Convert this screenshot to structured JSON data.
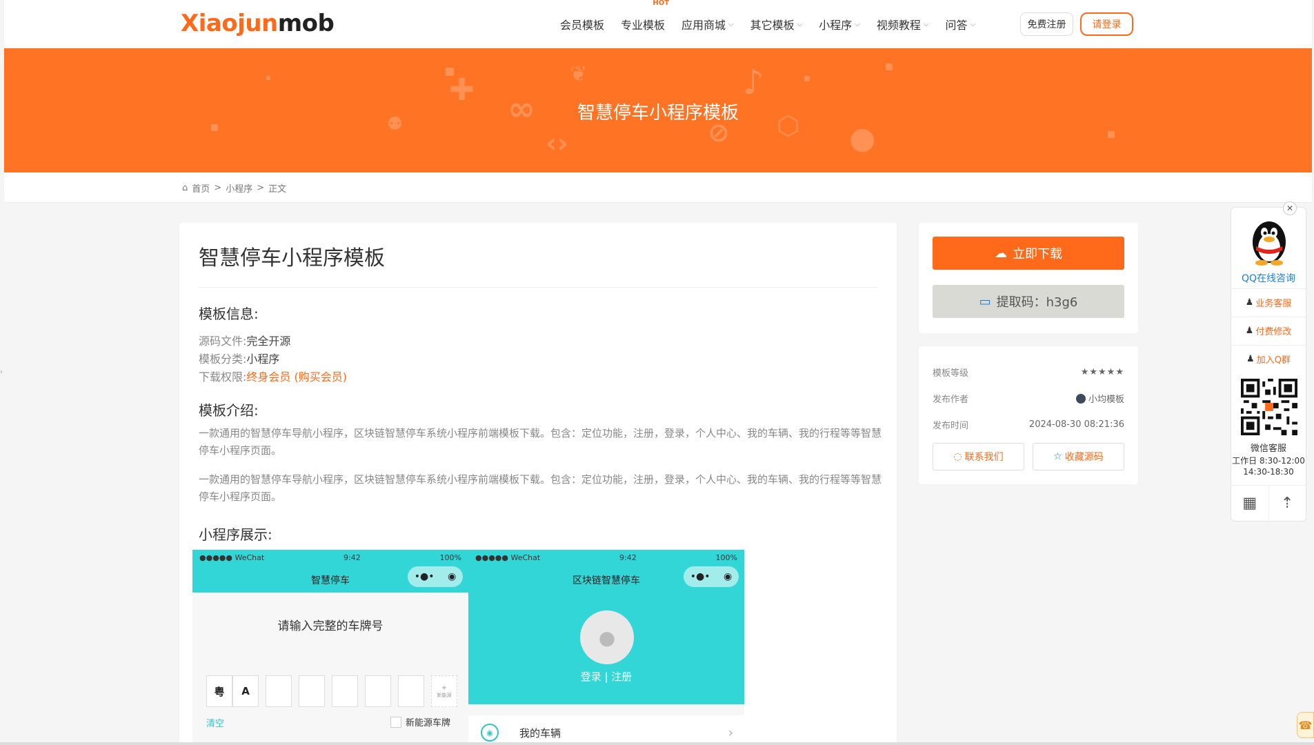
{
  "header": {
    "logo_part1": "Xiaojun",
    "logo_part2": "mob",
    "nav": [
      {
        "label": "会员模板",
        "chevron": false,
        "hot": false
      },
      {
        "label": "专业模板",
        "chevron": false,
        "hot": true
      },
      {
        "label": "应用商城",
        "chevron": true,
        "hot": false
      },
      {
        "label": "其它模板",
        "chevron": true,
        "hot": false
      },
      {
        "label": "小程序",
        "chevron": true,
        "hot": false
      },
      {
        "label": "视频教程",
        "chevron": true,
        "hot": false
      },
      {
        "label": "问答",
        "chevron": true,
        "hot": false
      }
    ],
    "hot_badge": "HOT",
    "register_label": "免费注册",
    "login_label": "请登录"
  },
  "banner": {
    "title": "智慧停车小程序模板"
  },
  "breadcrumb": {
    "home": "首页",
    "sep1": ">",
    "category": "小程序",
    "sep2": ">",
    "current": "正文"
  },
  "article": {
    "title": "智慧停车小程序模板",
    "info_heading": "模板信息:",
    "info": [
      {
        "key": "源码文件:",
        "value": "完全开源",
        "highlight": false
      },
      {
        "key": "模板分类:",
        "value": "小程序",
        "highlight": false
      },
      {
        "key": "下载权限:",
        "value": "终身会员  (购买会员)",
        "highlight": true
      }
    ],
    "intro_heading": "模板介绍:",
    "intro_paragraphs": [
      "一款通用的智慧停车导航小程序，区块链智慧停车系统小程序前端模板下载。包含：定位功能，注册，登录，个人中心、我的车辆、我的行程等等智慧停车小程序页面。",
      "一款通用的智慧停车导航小程序，区块链智慧停车系统小程序前端模板下载。包含：定位功能，注册，登录，个人中心、我的车辆、我的行程等等智慧停车小程序页面。"
    ],
    "showcase_heading": "小程序展示:"
  },
  "phone1": {
    "carrier": "●●●●● WeChat",
    "time": "9:42",
    "battery": "100%",
    "title": "智慧停车",
    "capsule_dots": "•●•",
    "capsule_target": "◉",
    "prompt": "请输入完整的车牌号",
    "province": "粤",
    "letter": "A",
    "new_energy_plus": "+",
    "new_energy_small": "新能源",
    "clear": "清空",
    "new_energy_label": "新能源车牌"
  },
  "phone2": {
    "carrier": "●●●●● WeChat",
    "time": "9:42",
    "battery": "100%",
    "title": "区块链智慧停车",
    "capsule_dots": "•●•",
    "capsule_target": "◉",
    "login_register": "登录 | 注册",
    "menu_item": "我的车辆"
  },
  "download": {
    "download_label": "立即下载",
    "code_label": "提取码：h3g6"
  },
  "meta": {
    "level_label": "模板等级",
    "level_stars": "★★★★★",
    "author_label": "发布作者",
    "author": "小均模板",
    "time_label": "发布时间",
    "time": "2024-08-30 08:21:36",
    "contact_label": "联系我们",
    "favorite_label": "收藏源码"
  },
  "service": {
    "close": "✕",
    "qq_online": "QQ在线咨询",
    "items": [
      "业务客服",
      "付费修改",
      "加入Q群"
    ],
    "wechat_label": "微信客服",
    "hours1": "工作日 8:30-12:00",
    "hours2": "14:30-18:30"
  },
  "colors": {
    "brand": "#ff6a1a",
    "banner": "#ff7324",
    "teal": "#33d6d6"
  }
}
